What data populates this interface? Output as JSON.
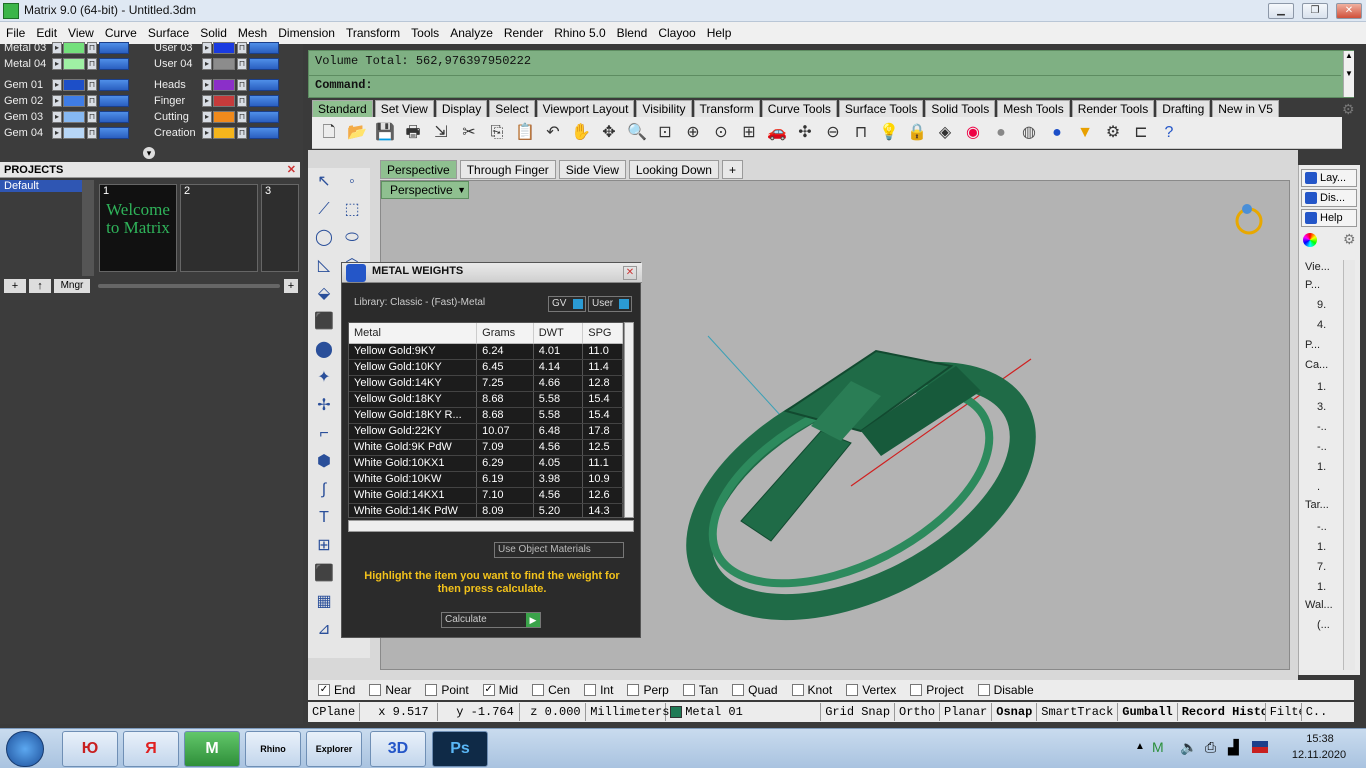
{
  "window": {
    "title": "Matrix 9.0 (64-bit) - Untitled.3dm",
    "minimize": "▁",
    "maximize": "❐",
    "close": "✕"
  },
  "menu": [
    "File",
    "Edit",
    "View",
    "Curve",
    "Surface",
    "Solid",
    "Mesh",
    "Dimension",
    "Transform",
    "Tools",
    "Analyze",
    "Render",
    "Rhino 5.0",
    "Blend",
    "Clayoo",
    "Help"
  ],
  "layers_left": [
    {
      "name": "Metal 03",
      "color": "#74e07c"
    },
    {
      "name": "Metal 04",
      "color": "#9ff0a4"
    },
    {
      "name": "Gem 01",
      "color": "#1d4fc8"
    },
    {
      "name": "Gem 02",
      "color": "#3f7de6"
    },
    {
      "name": "Gem 03",
      "color": "#86b8f2"
    },
    {
      "name": "Gem 04",
      "color": "#b7d6f6"
    }
  ],
  "layers_right": [
    {
      "name": "User 03",
      "color": "#1a3be0"
    },
    {
      "name": "User 04",
      "color": "#8c8c8c"
    },
    {
      "name": "Heads",
      "color": "#8b2fc9"
    },
    {
      "name": "Finger",
      "color": "#c63b3b"
    },
    {
      "name": "Cutting",
      "color": "#f08a1c"
    },
    {
      "name": "Creation",
      "color": "#f5b51c"
    }
  ],
  "projects": {
    "header": "PROJECTS",
    "item": "Default",
    "slots": [
      "1",
      "2",
      "3"
    ],
    "welcome": "Welcome to Matrix",
    "mngr": "Mngr"
  },
  "command": {
    "volume": "Volume Total: 562,976397950222",
    "prompt": "Command:"
  },
  "toolbar_tabs": [
    "Standard",
    "Set View",
    "Display",
    "Select",
    "Viewport Layout",
    "Visibility",
    "Transform",
    "Curve Tools",
    "Surface Tools",
    "Solid Tools",
    "Mesh Tools",
    "Render Tools",
    "Drafting",
    "New in V5"
  ],
  "viewport_tabs": [
    "Perspective",
    "Through Finger",
    "Side View",
    "Looking Down",
    "+"
  ],
  "viewport_label": "Perspective",
  "metal_weights": {
    "title": "METAL WEIGHTS",
    "library": "Library: Classic - (Fast)-Metal",
    "gv": "GV",
    "user": "User",
    "columns": [
      "Metal",
      "Grams",
      "DWT",
      "SPG"
    ],
    "rows": [
      [
        "Yellow Gold:9KY",
        "6.24",
        "4.01",
        "11.0"
      ],
      [
        "Yellow Gold:10KY",
        "6.45",
        "4.14",
        "11.4"
      ],
      [
        "Yellow Gold:14KY",
        "7.25",
        "4.66",
        "12.8"
      ],
      [
        "Yellow Gold:18KY",
        "8.68",
        "5.58",
        "15.4"
      ],
      [
        "Yellow Gold:18KY R...",
        "8.68",
        "5.58",
        "15.4"
      ],
      [
        "Yellow Gold:22KY",
        "10.07",
        "6.48",
        "17.8"
      ],
      [
        "White Gold:9K PdW",
        "7.09",
        "4.56",
        "12.5"
      ],
      [
        "White Gold:10KX1",
        "6.29",
        "4.05",
        "11.1"
      ],
      [
        "White Gold:10KW",
        "6.19",
        "3.98",
        "10.9"
      ],
      [
        "White Gold:14KX1",
        "7.10",
        "4.56",
        "12.6"
      ],
      [
        "White Gold:14K PdW",
        "8.09",
        "5.20",
        "14.3"
      ]
    ],
    "use_object_materials": "Use Object Materials",
    "hint": "Highlight the item you want to find the weight for then press calculate.",
    "calculate": "Calculate"
  },
  "right_panel": {
    "tabs": [
      "Lay...",
      "Dis...",
      "Help"
    ],
    "items": [
      "Vie...",
      "P...",
      "9.",
      "4.",
      "P...",
      "Ca...",
      "1.",
      "3.",
      "-..",
      "-..",
      "1.",
      ".",
      "Tar...",
      "-..",
      "1.",
      "7.",
      "1.",
      "Wal...",
      "(..."
    ]
  },
  "osnap": [
    {
      "label": "End",
      "checked": true
    },
    {
      "label": "Near",
      "checked": false
    },
    {
      "label": "Point",
      "checked": false
    },
    {
      "label": "Mid",
      "checked": true
    },
    {
      "label": "Cen",
      "checked": false
    },
    {
      "label": "Int",
      "checked": false
    },
    {
      "label": "Perp",
      "checked": false
    },
    {
      "label": "Tan",
      "checked": false
    },
    {
      "label": "Quad",
      "checked": false
    },
    {
      "label": "Knot",
      "checked": false
    },
    {
      "label": "Vertex",
      "checked": false
    },
    {
      "label": "Project",
      "checked": false
    },
    {
      "label": "Disable",
      "checked": false
    }
  ],
  "status": {
    "cplane": "CPlane",
    "x": "x 9.517",
    "y": "y -1.764",
    "z": "z 0.000",
    "units": "Millimeters",
    "layer": "Metal 01",
    "grid_snap": "Grid Snap",
    "ortho": "Ortho",
    "planar": "Planar",
    "osnap": "Osnap",
    "smarttrack": "SmartTrack",
    "gumball": "Gumball",
    "record": "Record Histo",
    "filter": "Filte",
    "c": "C..."
  },
  "taskbar": {
    "time": "15:38",
    "date": "12.11.2020",
    "apps": [
      "Ю",
      "Я",
      "M",
      "Rhino",
      "Explorer",
      "3D",
      "Ps"
    ]
  },
  "colors": {
    "matrix_green": "#8fc090",
    "ring": "#1f6b47",
    "dialog_hint": "#f2c21b"
  }
}
